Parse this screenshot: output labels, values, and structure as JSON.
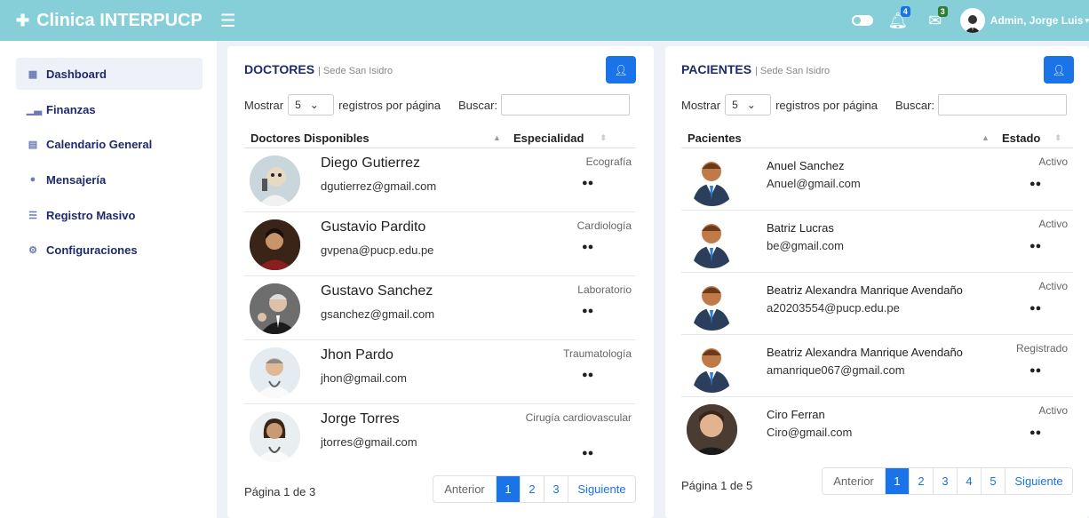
{
  "app": {
    "brand": "Clinica INTERPUCP",
    "admin_name": "Admin, Jorge Luis"
  },
  "header": {
    "notif_count": "4",
    "msg_count": "3"
  },
  "sidebar": {
    "items": [
      {
        "label": "Dashboard",
        "icon": "grid-icon"
      },
      {
        "label": "Finanzas",
        "icon": "chart-icon"
      },
      {
        "label": "Calendario General",
        "icon": "calendar-icon"
      },
      {
        "label": "Mensajería",
        "icon": "chat-icon"
      },
      {
        "label": "Registro Masivo",
        "icon": "list-icon"
      },
      {
        "label": "Configuraciones",
        "icon": "gear-icon"
      }
    ]
  },
  "doctors": {
    "title": "DOCTORES",
    "subtitle": "| Sede San Isidro",
    "show_label": "Mostrar",
    "show_value": "5",
    "per_page_label": "registros por página",
    "search_label": "Buscar:",
    "col1": "Doctores Disponibles",
    "col2": "Especialidad",
    "rows": [
      {
        "name": "Diego Gutierrez",
        "email": "dgutierrez@gmail.com",
        "specialty": "Ecografía"
      },
      {
        "name": "Gustavio Pardito",
        "email": "gvpena@pucp.edu.pe",
        "specialty": "Cardiología"
      },
      {
        "name": "Gustavo Sanchez",
        "email": "gsanchez@gmail.com",
        "specialty": "Laboratorio"
      },
      {
        "name": "Jhon Pardo",
        "email": "jhon@gmail.com",
        "specialty": "Traumatología"
      },
      {
        "name": "Jorge Torres",
        "email": "jtorres@gmail.com",
        "specialty": "Cirugía cardiovascular"
      }
    ],
    "page_info": "Página 1 de 3",
    "pager": [
      "Anterior",
      "1",
      "2",
      "3",
      "Siguiente"
    ]
  },
  "patients": {
    "title": "PACIENTES",
    "subtitle": "| Sede San Isidro",
    "show_label": "Mostrar",
    "show_value": "5",
    "per_page_label": "registros por página",
    "search_label": "Buscar:",
    "col1": "Pacientes",
    "col2": "Estado",
    "rows": [
      {
        "name": "Anuel Sanchez",
        "email": "Anuel@gmail.com",
        "status": "Activo"
      },
      {
        "name": "Batriz Lucras",
        "email": "be@gmail.com",
        "status": "Activo"
      },
      {
        "name": "Beatriz Alexandra Manrique Avendaño",
        "email": "a20203554@pucp.edu.pe",
        "status": "Activo"
      },
      {
        "name": "Beatriz Alexandra Manrique Avendaño",
        "email": "amanrique067@gmail.com",
        "status": "Registrado"
      },
      {
        "name": "Ciro Ferran",
        "email": "Ciro@gmail.com",
        "status": "Activo"
      }
    ],
    "page_info": "Página 1 de 5",
    "pager": [
      "Anterior",
      "1",
      "2",
      "3",
      "4",
      "5",
      "Siguiente"
    ]
  },
  "colors": {
    "accent": "#1a73e8",
    "topbar": "#86cfd9",
    "title": "#1f2a6b"
  }
}
